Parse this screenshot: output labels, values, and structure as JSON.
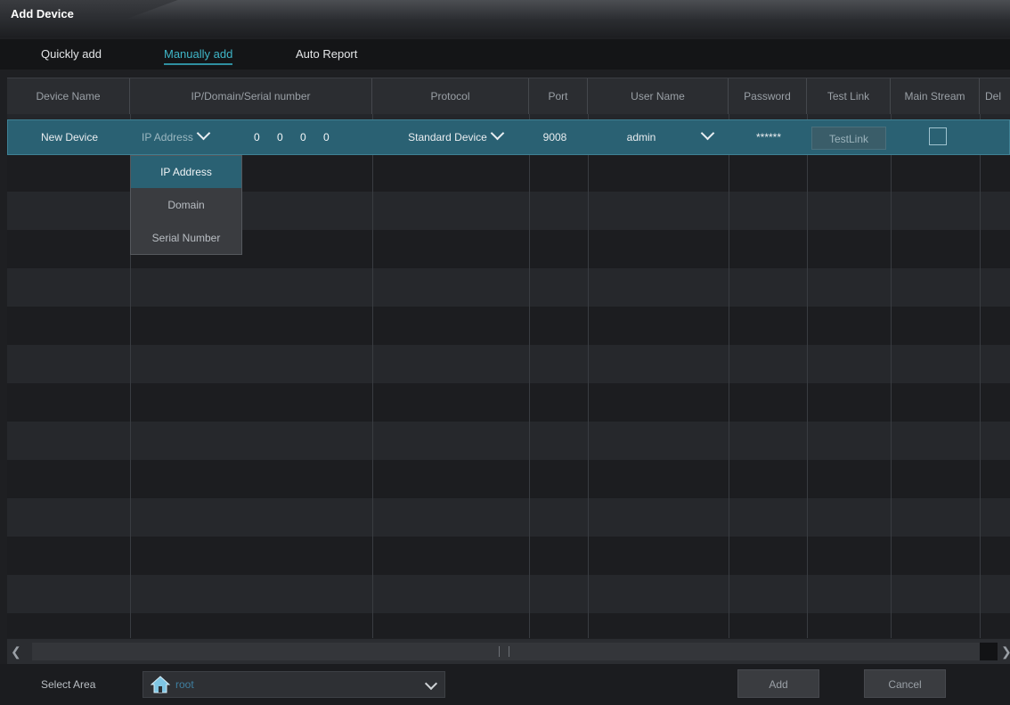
{
  "window": {
    "title": "Add Device"
  },
  "tabs": [
    {
      "label": "Quickly add",
      "active": false
    },
    {
      "label": "Manually add",
      "active": true
    },
    {
      "label": "Auto Report",
      "active": false
    }
  ],
  "table": {
    "columns": [
      "Device Name",
      "IP/Domain/Serial number",
      "Protocol",
      "Port",
      "User Name",
      "Password",
      "Test Link",
      "Main Stream",
      "Del"
    ],
    "selected_row": {
      "device_name": "New Device",
      "address_type": "IP Address",
      "ip_octets": [
        "0",
        "0",
        "0",
        "0"
      ],
      "protocol": "Standard Device",
      "port": "9008",
      "user_name": "admin",
      "password": "******",
      "test_link_label": "TestLink",
      "main_stream_checked": false
    }
  },
  "address_type_dropdown": {
    "options": [
      "IP Address",
      "Domain",
      "Serial Number"
    ],
    "selected": "IP Address"
  },
  "footer": {
    "select_area_label": "Select Area",
    "area_value": "root",
    "add_label": "Add",
    "cancel_label": "Cancel"
  },
  "colors": {
    "accent": "#2a6173",
    "tab_active": "#3fb6c8",
    "background": "#1e1f22"
  },
  "icons": [
    "chevron-down-icon",
    "home-icon",
    "scroll-left-icon",
    "scroll-right-icon"
  ]
}
